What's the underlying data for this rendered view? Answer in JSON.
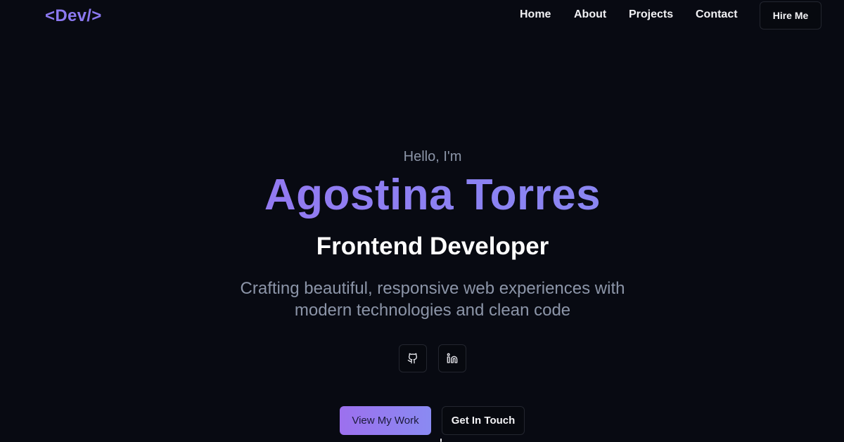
{
  "nav": {
    "logo": "<Dev/>",
    "links": [
      "Home",
      "About",
      "Projects",
      "Contact"
    ],
    "cta": "Hire Me"
  },
  "hero": {
    "greeting": "Hello, I'm",
    "name": "Agostina Torres",
    "role": "Frontend Developer",
    "tagline_line1": "Crafting beautiful, responsive web experiences with",
    "tagline_line2": "modern technologies and clean code",
    "social": [
      {
        "icon": "github-icon"
      },
      {
        "icon": "linkedin-icon"
      }
    ],
    "primary_button": "View My Work",
    "secondary_button": "Get In Touch"
  },
  "colors": {
    "background": "#080a12",
    "accent_start": "#9c70ee",
    "accent_end": "#8a8af2",
    "muted_text": "#8c95a8",
    "border": "#23262f"
  }
}
